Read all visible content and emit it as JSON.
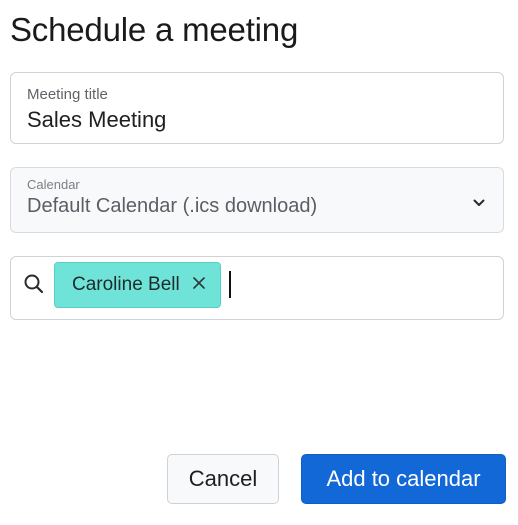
{
  "dialog": {
    "title": "Schedule a meeting"
  },
  "meeting_title": {
    "label": "Meeting title",
    "value": "Sales Meeting"
  },
  "calendar": {
    "label": "Calendar",
    "selected": "Default Calendar (.ics download)"
  },
  "attendees": {
    "chips": [
      {
        "label": "Caroline Bell"
      }
    ]
  },
  "actions": {
    "cancel_label": "Cancel",
    "submit_label": "Add to calendar"
  },
  "icons": {
    "search": "search-icon",
    "chevron": "chevron-down-icon",
    "remove": "close-icon"
  },
  "colors": {
    "chip_background": "#6fe3d7",
    "primary_button": "#1168d6"
  }
}
